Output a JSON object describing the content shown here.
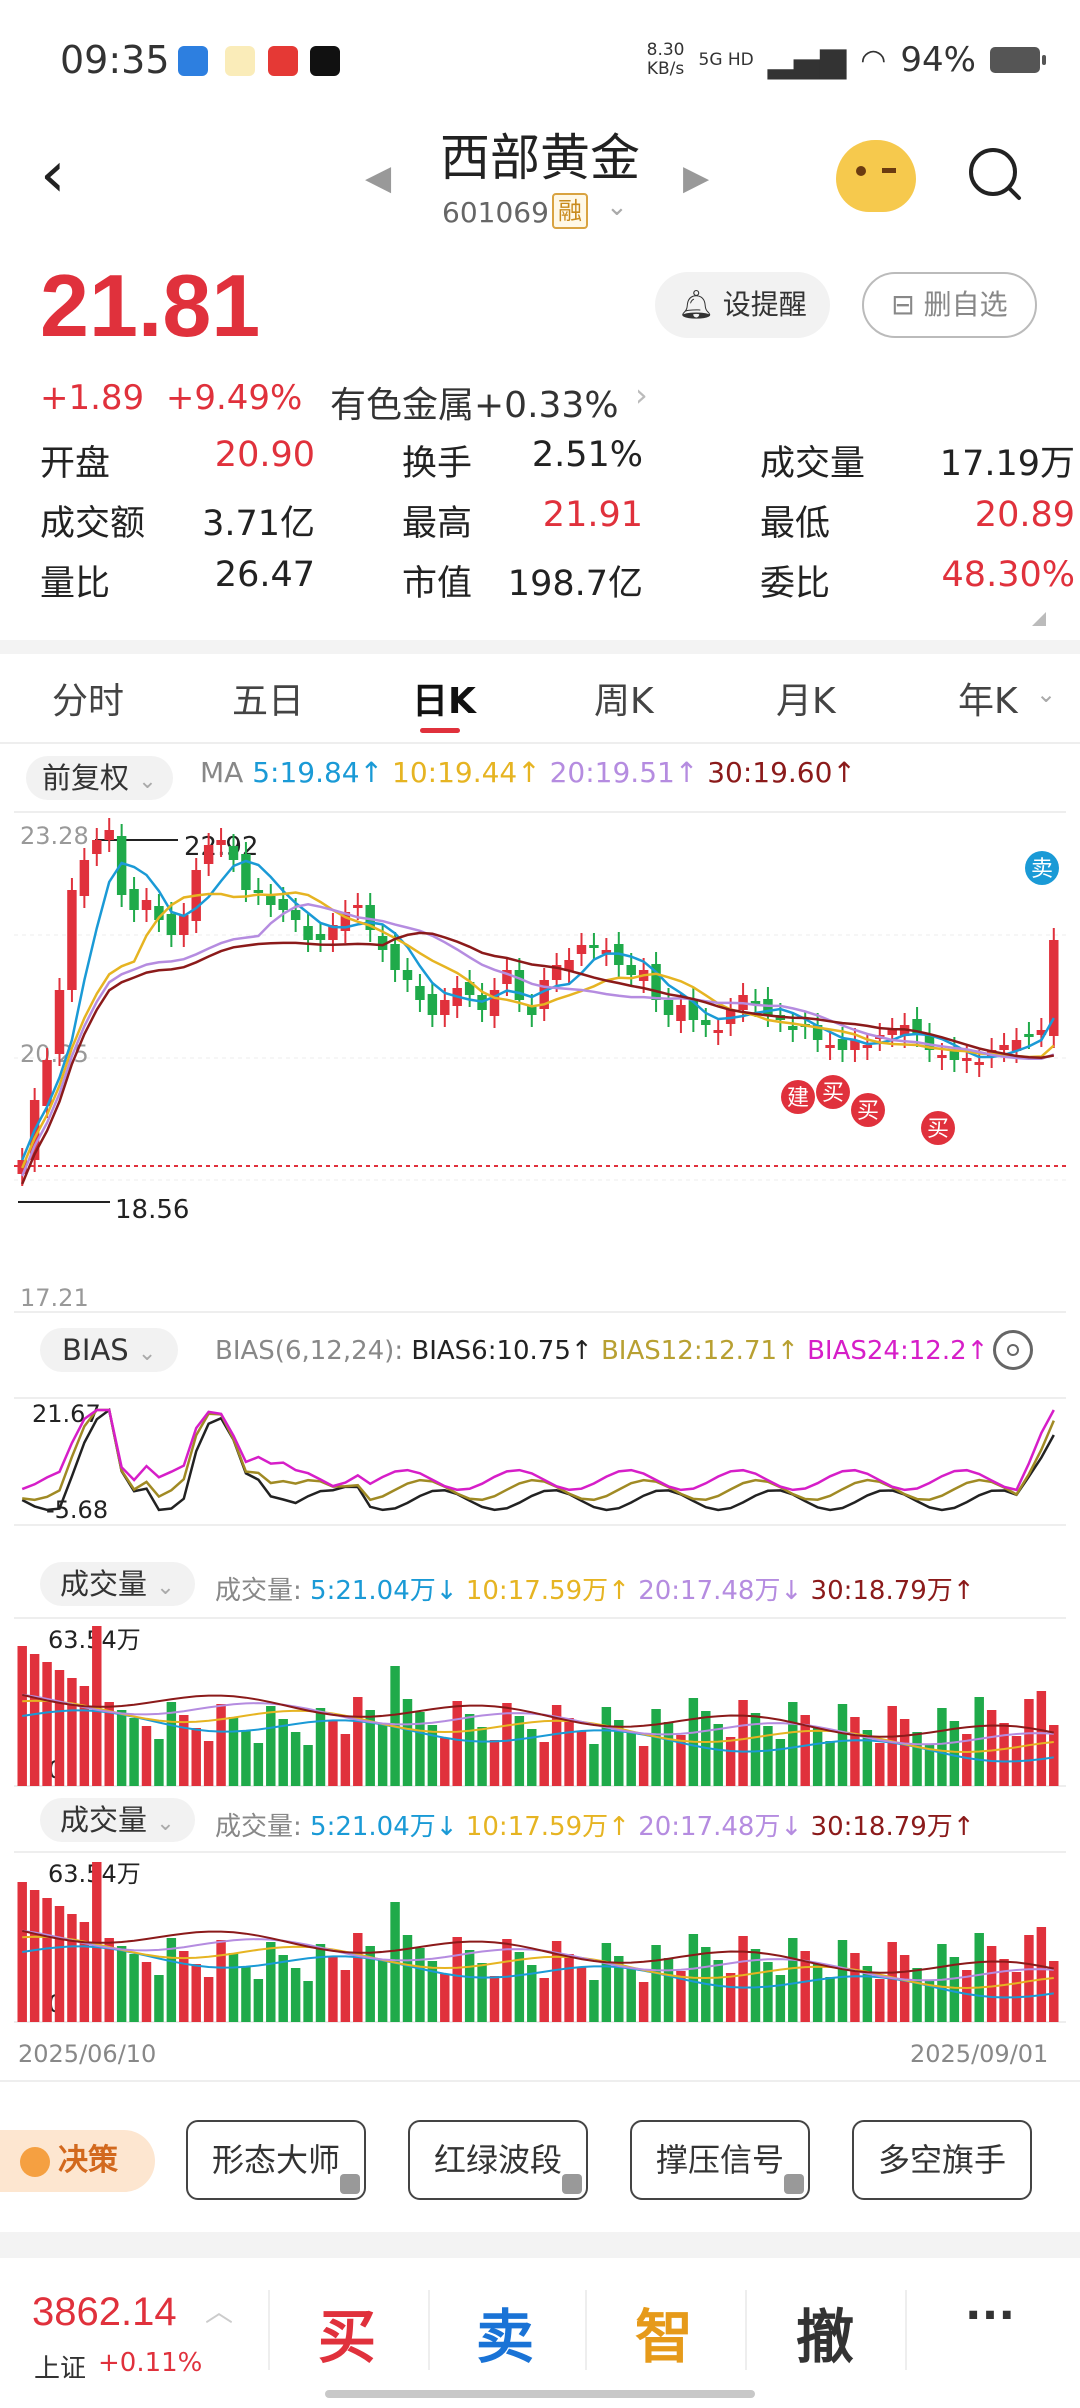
{
  "status_bar": {
    "time": "09:35",
    "speed_value": "8.30",
    "speed_unit": "KB/s",
    "network": "5G HD",
    "battery": "94%"
  },
  "header": {
    "name": "西部黄金",
    "code": "601069",
    "badge": "融"
  },
  "price": {
    "last": "21.81",
    "change": "+1.89",
    "change_pct": "+9.49%",
    "sector": "有色金属+0.33%",
    "alert_label": "设提醒",
    "remove_label": "删自选"
  },
  "quote": [
    [
      {
        "label": "开盘",
        "value": "20.90",
        "color": "red"
      },
      {
        "label": "换手",
        "value": "2.51%",
        "color": "dark"
      },
      {
        "label": "成交量",
        "value": "17.19万",
        "color": "dark"
      }
    ],
    [
      {
        "label": "成交额",
        "value": "3.71亿",
        "color": "dark"
      },
      {
        "label": "最高",
        "value": "21.91",
        "color": "red"
      },
      {
        "label": "最低",
        "value": "20.89",
        "color": "red"
      }
    ],
    [
      {
        "label": "量比",
        "value": "26.47",
        "color": "dark"
      },
      {
        "label": "市值",
        "value": "198.7亿",
        "color": "dark"
      },
      {
        "label": "委比",
        "value": "48.30%",
        "color": "red"
      }
    ]
  ],
  "tabs": [
    "分时",
    "五日",
    "日K",
    "周K",
    "月K",
    "年K"
  ],
  "active_tab": "日K",
  "ma": {
    "mode": "前复权",
    "label": "MA",
    "ma5": "5:19.84",
    "ma10": "10:19.44",
    "ma20": "20:19.51",
    "ma30": "30:19.60"
  },
  "kline": {
    "y_top": "23.28",
    "y_mid": "20.25",
    "y_bottom": "17.21",
    "high_mark": "22.92",
    "low_mark": "18.56",
    "signals": [
      "建",
      "买",
      "买",
      "买",
      "卖"
    ]
  },
  "bias": {
    "selector": "BIAS",
    "params": "BIAS(6,12,24):",
    "b6": "BIAS6:10.75",
    "b12": "BIAS12:12.71",
    "b24": "BIAS24:12.2",
    "top": "21.67",
    "bottom": "-5.68"
  },
  "volume": {
    "selector": "成交量",
    "label": "成交量:",
    "v5": "5:21.04万",
    "v10": "10:17.59万",
    "v20": "20:17.48万",
    "v30": "30:18.79万",
    "max": "63.54万",
    "zero": "0"
  },
  "dates": {
    "start": "2025/06/10",
    "end": "2025/09/01"
  },
  "features": {
    "decision": "决策",
    "buttons": [
      "形态大师",
      "红绿波段",
      "撑压信号",
      "多空旗手"
    ]
  },
  "bottom": {
    "index_value": "3862.14",
    "index_name": "上证",
    "index_change": "+0.11%",
    "buy": "买",
    "sell": "卖",
    "smart": "智",
    "cancel": "撤",
    "more": "···"
  },
  "colors": {
    "up": "#e0313c",
    "down": "#1faa4a",
    "ma5": "#1a9ad6",
    "ma10": "#e6b422",
    "ma20": "#b58ce0",
    "ma30": "#8b1a1a"
  }
}
